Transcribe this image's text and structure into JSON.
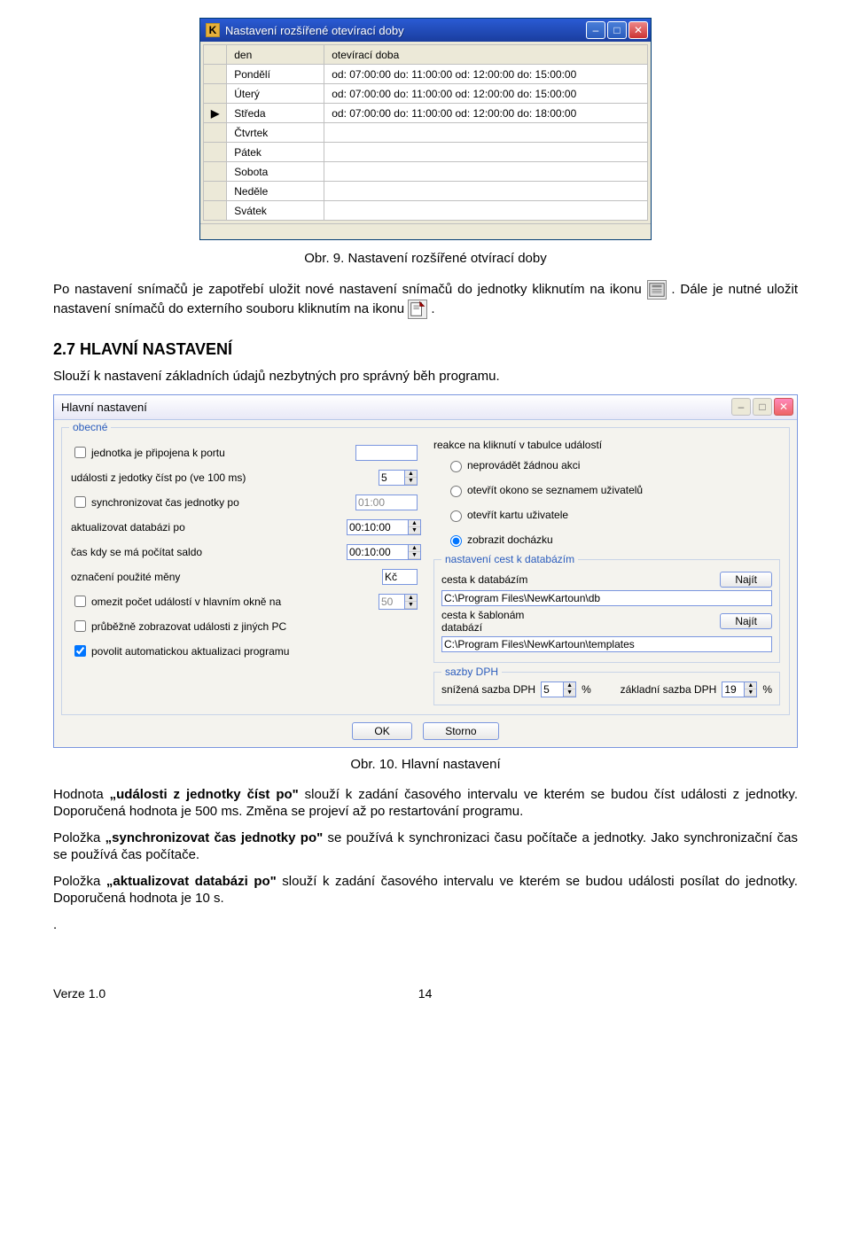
{
  "window1": {
    "title": "Nastavení rozšířené otevírací doby",
    "icon_letter": "K",
    "columns": [
      "den",
      "otevírací doba"
    ],
    "rows": [
      {
        "marker": "",
        "day": "Pondělí",
        "hours": "od: 07:00:00 do: 11:00:00 od: 12:00:00 do: 15:00:00"
      },
      {
        "marker": "",
        "day": "Úterý",
        "hours": "od: 07:00:00 do: 11:00:00 od: 12:00:00 do: 15:00:00"
      },
      {
        "marker": "▶",
        "day": "Středa",
        "hours": "od: 07:00:00 do: 11:00:00 od: 12:00:00 do: 18:00:00"
      },
      {
        "marker": "",
        "day": "Čtvrtek",
        "hours": ""
      },
      {
        "marker": "",
        "day": "Pátek",
        "hours": ""
      },
      {
        "marker": "",
        "day": "Sobota",
        "hours": ""
      },
      {
        "marker": "",
        "day": "Neděle",
        "hours": ""
      },
      {
        "marker": "",
        "day": "Svátek",
        "hours": ""
      }
    ]
  },
  "caption1": "Obr. 9. Nastavení rozšířené otvírací doby",
  "para1a": "Po nastavení snímačů je zapotřebí uložit nové nastavení snímačů do jednotky kliknutím na ikonu ",
  "para1b": ". Dále je nutné uložit nastavení snímačů do externího souboru kliknutím na ikonu ",
  "para1c": ".",
  "section_heading": "2.7   HLAVNÍ NASTAVENÍ",
  "para2": "Slouží k nastavení  základních údajů nezbytných pro správný běh programu.",
  "window2": {
    "title": "Hlavní nastavení",
    "group_general": "obecné",
    "left": {
      "chk_port": "jednotka je připojena k portu",
      "lbl_read": "události z jedotky číst po (ve 100 ms)",
      "val_read": "5",
      "chk_sync": "synchronizovat čas jednotky po",
      "val_sync": "01:00",
      "lbl_updatedb": "aktualizovat databázi po",
      "val_updatedb": "00:10:00",
      "lbl_saldo": "čas kdy se má počítat saldo",
      "val_saldo": "00:10:00",
      "lbl_currency": "označení použité měny",
      "val_currency": "Kč",
      "chk_limit": "omezit počet událostí v hlavním okně na",
      "val_limit": "50",
      "chk_other_pc": "průběžně zobrazovat události z jiných PC",
      "chk_autoupdate": "povolit automatickou aktualizaci programu"
    },
    "right": {
      "lbl_reaction": "reakce na kliknutí v tabulce událostí",
      "r1": "neprovádět žádnou akci",
      "r2": "otevřít okono se seznamem uživatelů",
      "r3": "otevřít kartu uživatele",
      "r4": "zobrazit docházku",
      "group_paths": "nastavení cest k databázím",
      "lbl_dbpath": "cesta k databázím",
      "val_dbpath": "C:\\Program Files\\NewKartoun\\db",
      "lbl_tplpath": "cesta k šablonám databází",
      "val_tplpath": "C:\\Program Files\\NewKartoun\\templates",
      "btn_find": "Najít",
      "group_dph": "sazby DPH",
      "lbl_dph_low": "snížená sazba DPH",
      "val_dph_low": "5",
      "lbl_dph_base": "základní sazba DPH",
      "val_dph_base": "19",
      "pct": "%"
    },
    "btn_ok": "OK",
    "btn_cancel": "Storno"
  },
  "caption2": "Obr. 10. Hlavní nastavení",
  "para3": "Hodnota „události z jednotky číst po\" slouží k zadání časového intervalu ve kterém se budou číst události z jednotky. Doporučená hodnota je 500 ms. Změna se projeví až po restartování programu.",
  "para4": "Položka „synchronizovat čas jednotky po\" se používá k synchronizaci času počítače a jednotky. Jako synchronizační čas se používá čas počítače.",
  "para5": "Položka „aktualizovat databázi po\" slouží k zadání časového intervalu ve kterém se budou události posílat do jednotky. Doporučená hodnota je 10 s.",
  "footer_version": "Verze 1.0",
  "footer_page": "14"
}
